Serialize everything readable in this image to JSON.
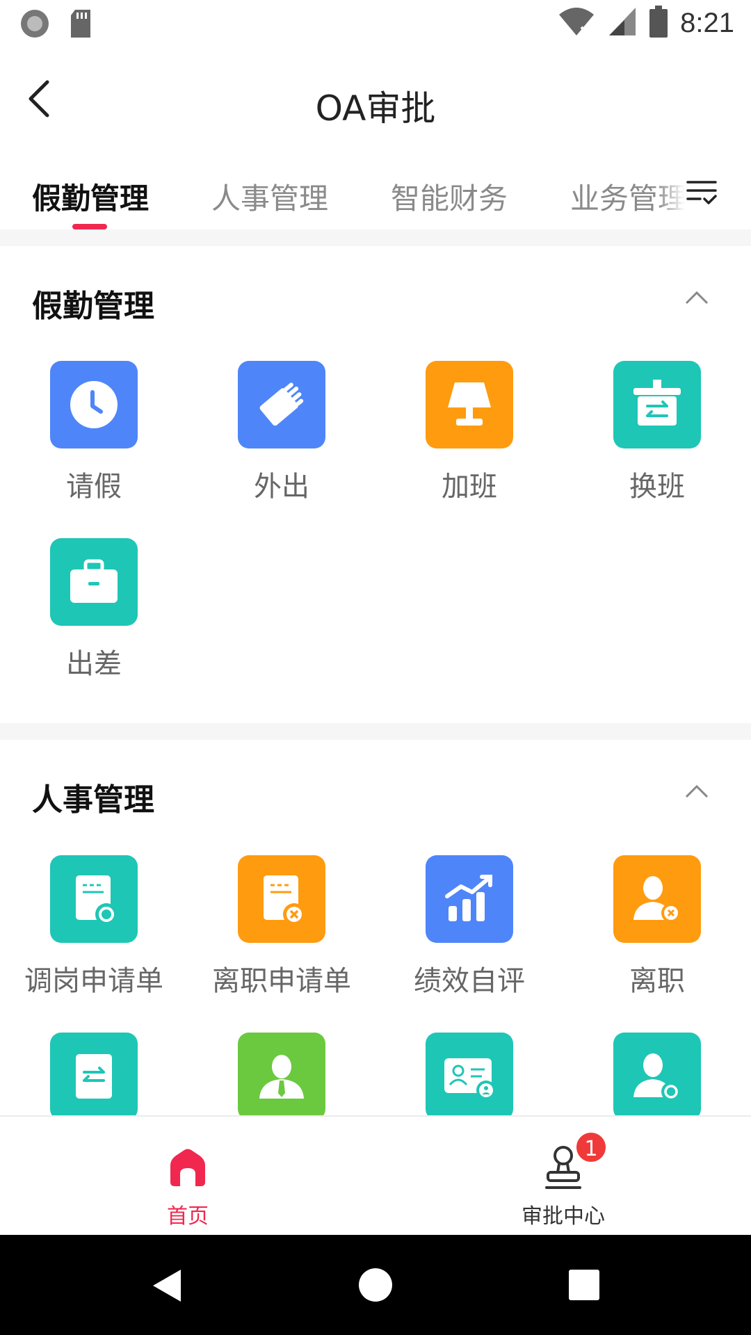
{
  "status_bar": {
    "time": "8:21"
  },
  "header": {
    "title": "OA审批"
  },
  "tabs": [
    {
      "label": "假勤管理"
    },
    {
      "label": "人事管理"
    },
    {
      "label": "智能财务"
    },
    {
      "label": "业务管理"
    }
  ],
  "sections": {
    "attendance": {
      "title": "假勤管理",
      "items": [
        {
          "label": "请假",
          "icon": "clock-icon",
          "color": "#4e86f9"
        },
        {
          "label": "外出",
          "icon": "hand-icon",
          "color": "#4e86f9"
        },
        {
          "label": "加班",
          "icon": "lamp-icon",
          "color": "#ff9b0f"
        },
        {
          "label": "换班",
          "icon": "swap-sign-icon",
          "color": "#1ec6b6"
        },
        {
          "label": "出差",
          "icon": "briefcase-icon",
          "color": "#1ec6b6"
        }
      ]
    },
    "hr": {
      "title": "人事管理",
      "items": [
        {
          "label": "调岗申请单",
          "icon": "transfer-form-icon",
          "color": "#1ec6b6"
        },
        {
          "label": "离职申请单",
          "icon": "resign-form-icon",
          "color": "#ff9b0f"
        },
        {
          "label": "绩效自评",
          "icon": "chart-up-icon",
          "color": "#4e86f9"
        },
        {
          "label": "离职",
          "icon": "user-remove-icon",
          "color": "#ff9b0f"
        },
        {
          "label": "",
          "icon": "exchange-doc-icon",
          "color": "#1ec6b6"
        },
        {
          "label": "",
          "icon": "employee-icon",
          "color": "#6bc940"
        },
        {
          "label": "",
          "icon": "id-card-icon",
          "color": "#1ec6b6"
        },
        {
          "label": "",
          "icon": "user-sync-icon",
          "color": "#1ec6b6"
        }
      ]
    }
  },
  "bottom_nav": {
    "home": {
      "label": "首页",
      "color": "#f0284f"
    },
    "approval": {
      "label": "审批中心",
      "badge": "1"
    }
  }
}
